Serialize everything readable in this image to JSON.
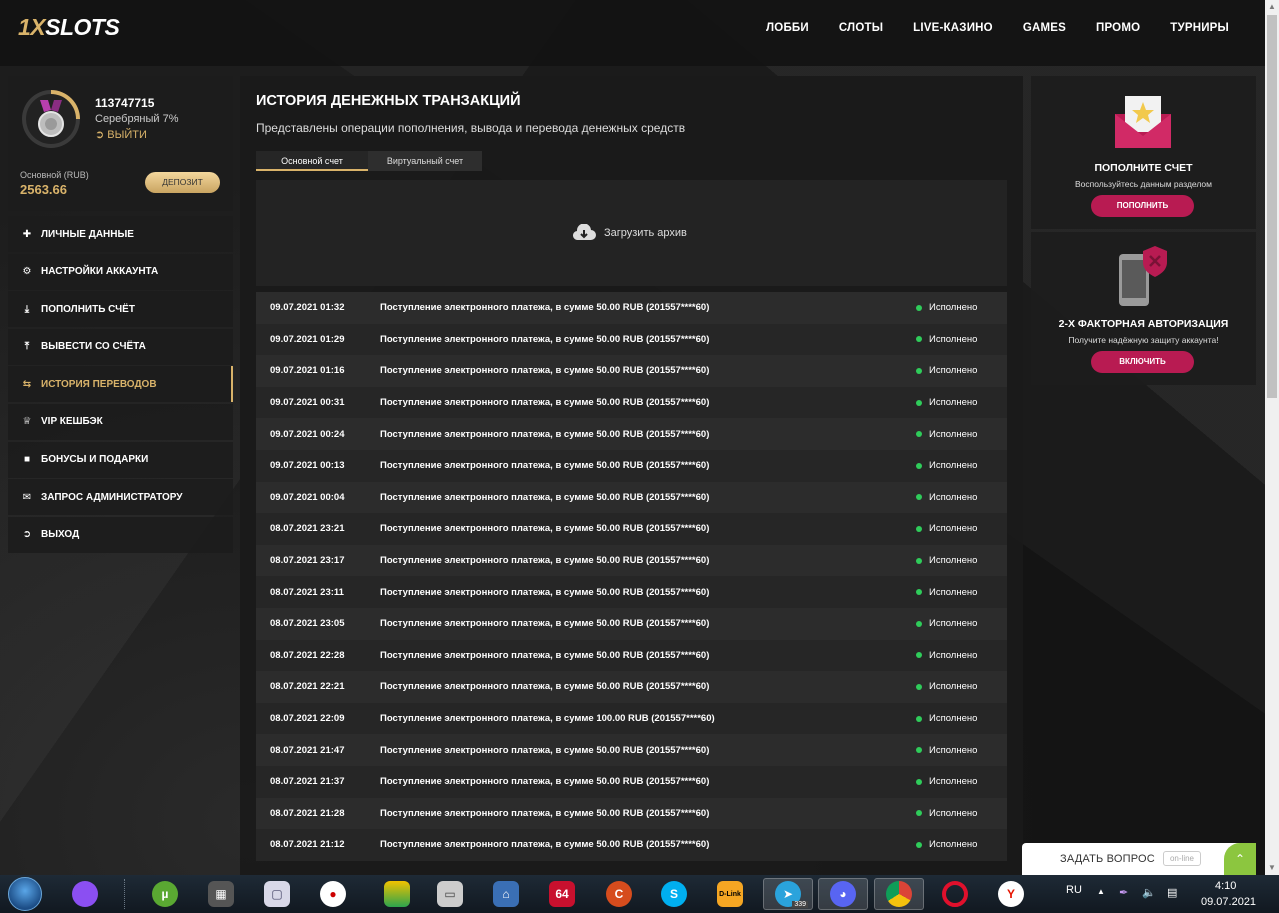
{
  "header": {
    "logo_prefix": "1X",
    "logo_main": "SLOTS",
    "nav": [
      "ЛОББИ",
      "СЛОТЫ",
      "LIVE-КАЗИНО",
      "GAMES",
      "ПРОМО",
      "ТУРНИРЫ"
    ]
  },
  "profile": {
    "user_id": "113747715",
    "level": "Серебряный 7%",
    "logout": "ВЫЙТИ",
    "balance_label": "Основной (RUB)",
    "balance_value": "2563.66",
    "deposit_button": "ДЕПОЗИТ",
    "level_progress": 0.25
  },
  "menu": [
    {
      "label": "ЛИЧНЫЕ ДАННЫЕ",
      "icon": "user-add-icon"
    },
    {
      "label": "НАСТРОЙКИ АККАУНТА",
      "icon": "gears-icon"
    },
    {
      "label": "ПОПОЛНИТЬ СЧЁТ",
      "icon": "download-icon"
    },
    {
      "label": "ВЫВЕСТИ СО СЧЁТА",
      "icon": "upload-icon"
    },
    {
      "label": "ИСТОРИЯ ПЕРЕВОДОВ",
      "icon": "transfer-icon",
      "active": true
    },
    {
      "label": "VIP КЕШБЭК",
      "icon": "crown-icon"
    },
    {
      "label": "БОНУСЫ И ПОДАРКИ",
      "icon": "gift-icon"
    },
    {
      "label": "ЗАПРОС АДМИНИСТРАТОРУ",
      "icon": "envelope-icon"
    },
    {
      "label": "ВЫХОД",
      "icon": "exit-icon"
    }
  ],
  "main": {
    "title": "ИСТОРИЯ ДЕНЕЖНЫХ ТРАНЗАКЦИЙ",
    "subtitle": "Представлены операции пополнения, вывода и перевода денежных средств",
    "tabs": [
      "Основной счет",
      "Виртуальный счет"
    ],
    "archive_button": "Загрузить архив",
    "transactions": [
      {
        "date": "09.07.2021 01:32",
        "desc": "Поступление электронного платежа, в сумме 50.00 RUB (201557****60)",
        "status": "Исполнено"
      },
      {
        "date": "09.07.2021 01:29",
        "desc": "Поступление электронного платежа, в сумме 50.00 RUB (201557****60)",
        "status": "Исполнено"
      },
      {
        "date": "09.07.2021 01:16",
        "desc": "Поступление электронного платежа, в сумме 50.00 RUB (201557****60)",
        "status": "Исполнено"
      },
      {
        "date": "09.07.2021 00:31",
        "desc": "Поступление электронного платежа, в сумме 50.00 RUB (201557****60)",
        "status": "Исполнено"
      },
      {
        "date": "09.07.2021 00:24",
        "desc": "Поступление электронного платежа, в сумме 50.00 RUB (201557****60)",
        "status": "Исполнено"
      },
      {
        "date": "09.07.2021 00:13",
        "desc": "Поступление электронного платежа, в сумме 50.00 RUB (201557****60)",
        "status": "Исполнено"
      },
      {
        "date": "09.07.2021 00:04",
        "desc": "Поступление электронного платежа, в сумме 50.00 RUB (201557****60)",
        "status": "Исполнено"
      },
      {
        "date": "08.07.2021 23:21",
        "desc": "Поступление электронного платежа, в сумме 50.00 RUB (201557****60)",
        "status": "Исполнено"
      },
      {
        "date": "08.07.2021 23:17",
        "desc": "Поступление электронного платежа, в сумме 50.00 RUB (201557****60)",
        "status": "Исполнено"
      },
      {
        "date": "08.07.2021 23:11",
        "desc": "Поступление электронного платежа, в сумме 50.00 RUB (201557****60)",
        "status": "Исполнено"
      },
      {
        "date": "08.07.2021 23:05",
        "desc": "Поступление электронного платежа, в сумме 50.00 RUB (201557****60)",
        "status": "Исполнено"
      },
      {
        "date": "08.07.2021 22:28",
        "desc": "Поступление электронного платежа, в сумме 50.00 RUB (201557****60)",
        "status": "Исполнено"
      },
      {
        "date": "08.07.2021 22:21",
        "desc": "Поступление электронного платежа, в сумме 50.00 RUB (201557****60)",
        "status": "Исполнено"
      },
      {
        "date": "08.07.2021 22:09",
        "desc": "Поступление электронного платежа, в сумме 100.00 RUB (201557****60)",
        "status": "Исполнено"
      },
      {
        "date": "08.07.2021 21:47",
        "desc": "Поступление электронного платежа, в сумме 50.00 RUB (201557****60)",
        "status": "Исполнено"
      },
      {
        "date": "08.07.2021 21:37",
        "desc": "Поступление электронного платежа, в сумме 50.00 RUB (201557****60)",
        "status": "Исполнено"
      },
      {
        "date": "08.07.2021 21:28",
        "desc": "Поступление электронного платежа, в сумме 50.00 RUB (201557****60)",
        "status": "Исполнено"
      },
      {
        "date": "08.07.2021 21:12",
        "desc": "Поступление электронного платежа, в сумме 50.00 RUB (201557****60)",
        "status": "Исполнено"
      }
    ],
    "status_color": "#2fcc5a"
  },
  "promos": [
    {
      "title": "ПОПОЛНИТЕ СЧЕТ",
      "subtitle": "Воспользуйтесь данным разделом",
      "button": "ПОПОЛНИТЬ",
      "icon": "envelope-star-icon"
    },
    {
      "title": "2-Х ФАКТОРНАЯ АВТОРИЗАЦИЯ",
      "subtitle": "Получите надёжную защиту аккаунта!",
      "button": "ВКЛЮЧИТЬ",
      "icon": "phone-shield-icon"
    }
  ],
  "chat": {
    "label": "ЗАДАТЬ ВОПРОС",
    "status": "on-line"
  },
  "taskbar": {
    "badges": {
      "telegram": "339"
    },
    "tray_lang": "RU",
    "time": "4:10",
    "date": "09.07.2021"
  },
  "colors": {
    "accent": "#d9b36a",
    "promo_button": "#b81b52",
    "success": "#2fcc5a"
  }
}
